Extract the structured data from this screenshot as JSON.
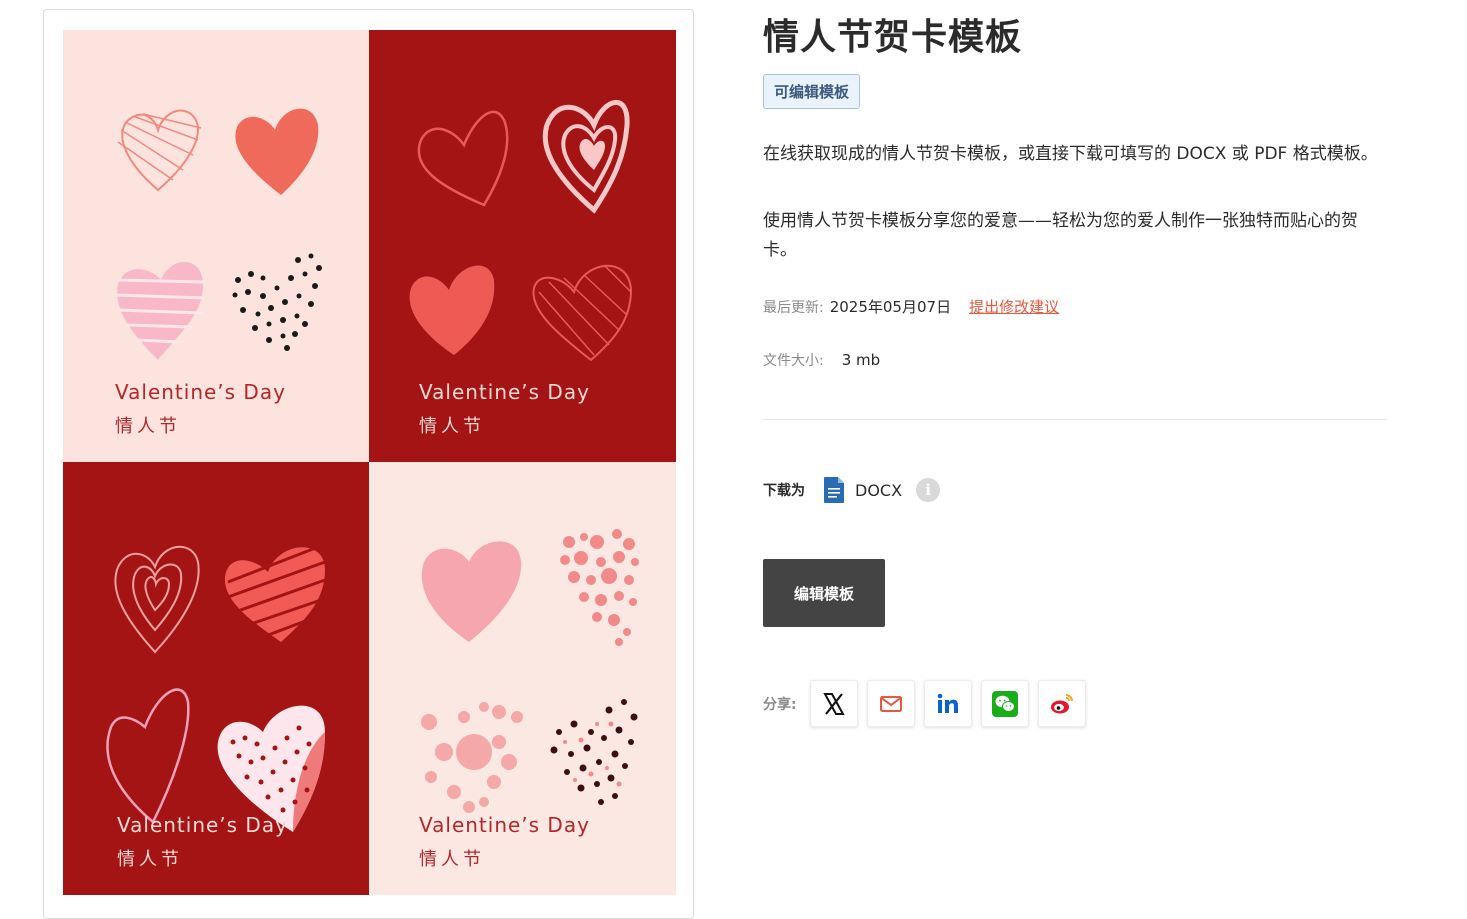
{
  "preview": {
    "cards": [
      {
        "title": "Valentine’s Day",
        "subtitle": "情人节"
      },
      {
        "title": "Valentine’s Day",
        "subtitle": "情人节"
      },
      {
        "title": "Valentine’s Day",
        "subtitle": "情人节"
      },
      {
        "title": "Valentine’s Day",
        "subtitle": "情人节"
      }
    ]
  },
  "header": {
    "title": "情人节贺卡模板",
    "badge": "可编辑模板"
  },
  "description": [
    "在线获取现成的情人节贺卡模板，或直接下载可填写的 DOCX 或 PDF 格式模板。",
    "使用情人节贺卡模板分享您的爱意——轻松为您的爱人制作一张独特而贴心的贺卡。"
  ],
  "meta": {
    "updated_label": "最后更新:",
    "updated_value": "2025年05月07日",
    "suggest_link": "提出修改建议",
    "size_label": "文件大小:",
    "size_value": "3 mb"
  },
  "download": {
    "label": "下载为",
    "format": "DOCX",
    "info_glyph": "i"
  },
  "actions": {
    "edit_label": "编辑模板"
  },
  "share": {
    "label": "分享:",
    "networks": [
      "x-icon",
      "email-icon",
      "linkedin-icon",
      "wechat-icon",
      "weibo-icon"
    ]
  },
  "colors": {
    "accent_link": "#e8583f",
    "button_dark": "#444444",
    "badge_text": "#3d5a80",
    "card_red": "#a51414",
    "card_pink": "#fce3dd"
  }
}
